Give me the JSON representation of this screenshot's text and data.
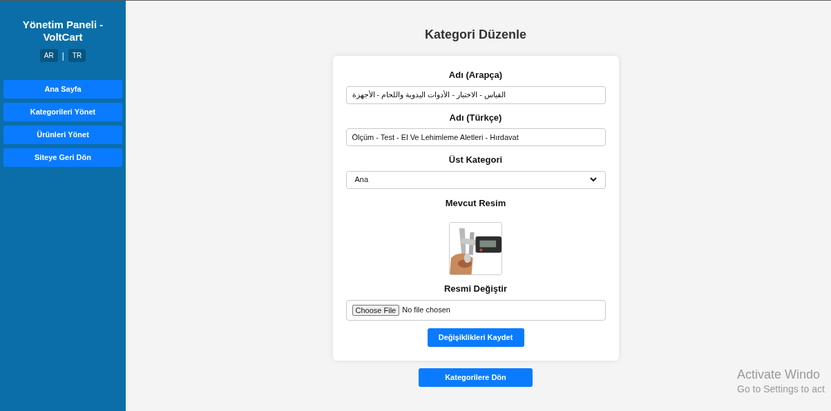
{
  "sidebar": {
    "title": "Yönetim Paneli - VoltCart",
    "languages": [
      "AR",
      "TR"
    ],
    "separator": "|",
    "items": [
      "Ana Sayfa",
      "Kategorileri Yönet",
      "Ürünleri Yönet",
      "Siteye Geri Dön"
    ]
  },
  "page": {
    "title": "Kategori Düzenle"
  },
  "form": {
    "name_ar": {
      "label": "Adı (Arapça)",
      "value": "القياس - الاختبار - الأدوات اليدوية واللحام - الأجهزة"
    },
    "name_tr": {
      "label": "Adı (Türkçe)",
      "value": "Ölçüm - Test - El Ve Lehimleme Aletleri - Hırdavat"
    },
    "parent": {
      "label": "Üst Kategori",
      "value": "Ana"
    },
    "current_image": {
      "label": "Mevcut Resim",
      "kind": "picture"
    },
    "change_image": {
      "label": "Resmi Değiştir",
      "button": "Choose File",
      "status": "No file chosen"
    },
    "submit": "Değişiklikleri Kaydet"
  },
  "back_button": "Kategorilere Dön",
  "activation": {
    "title": "Activate Windo",
    "subtitle": "Go to Settings to act"
  }
}
